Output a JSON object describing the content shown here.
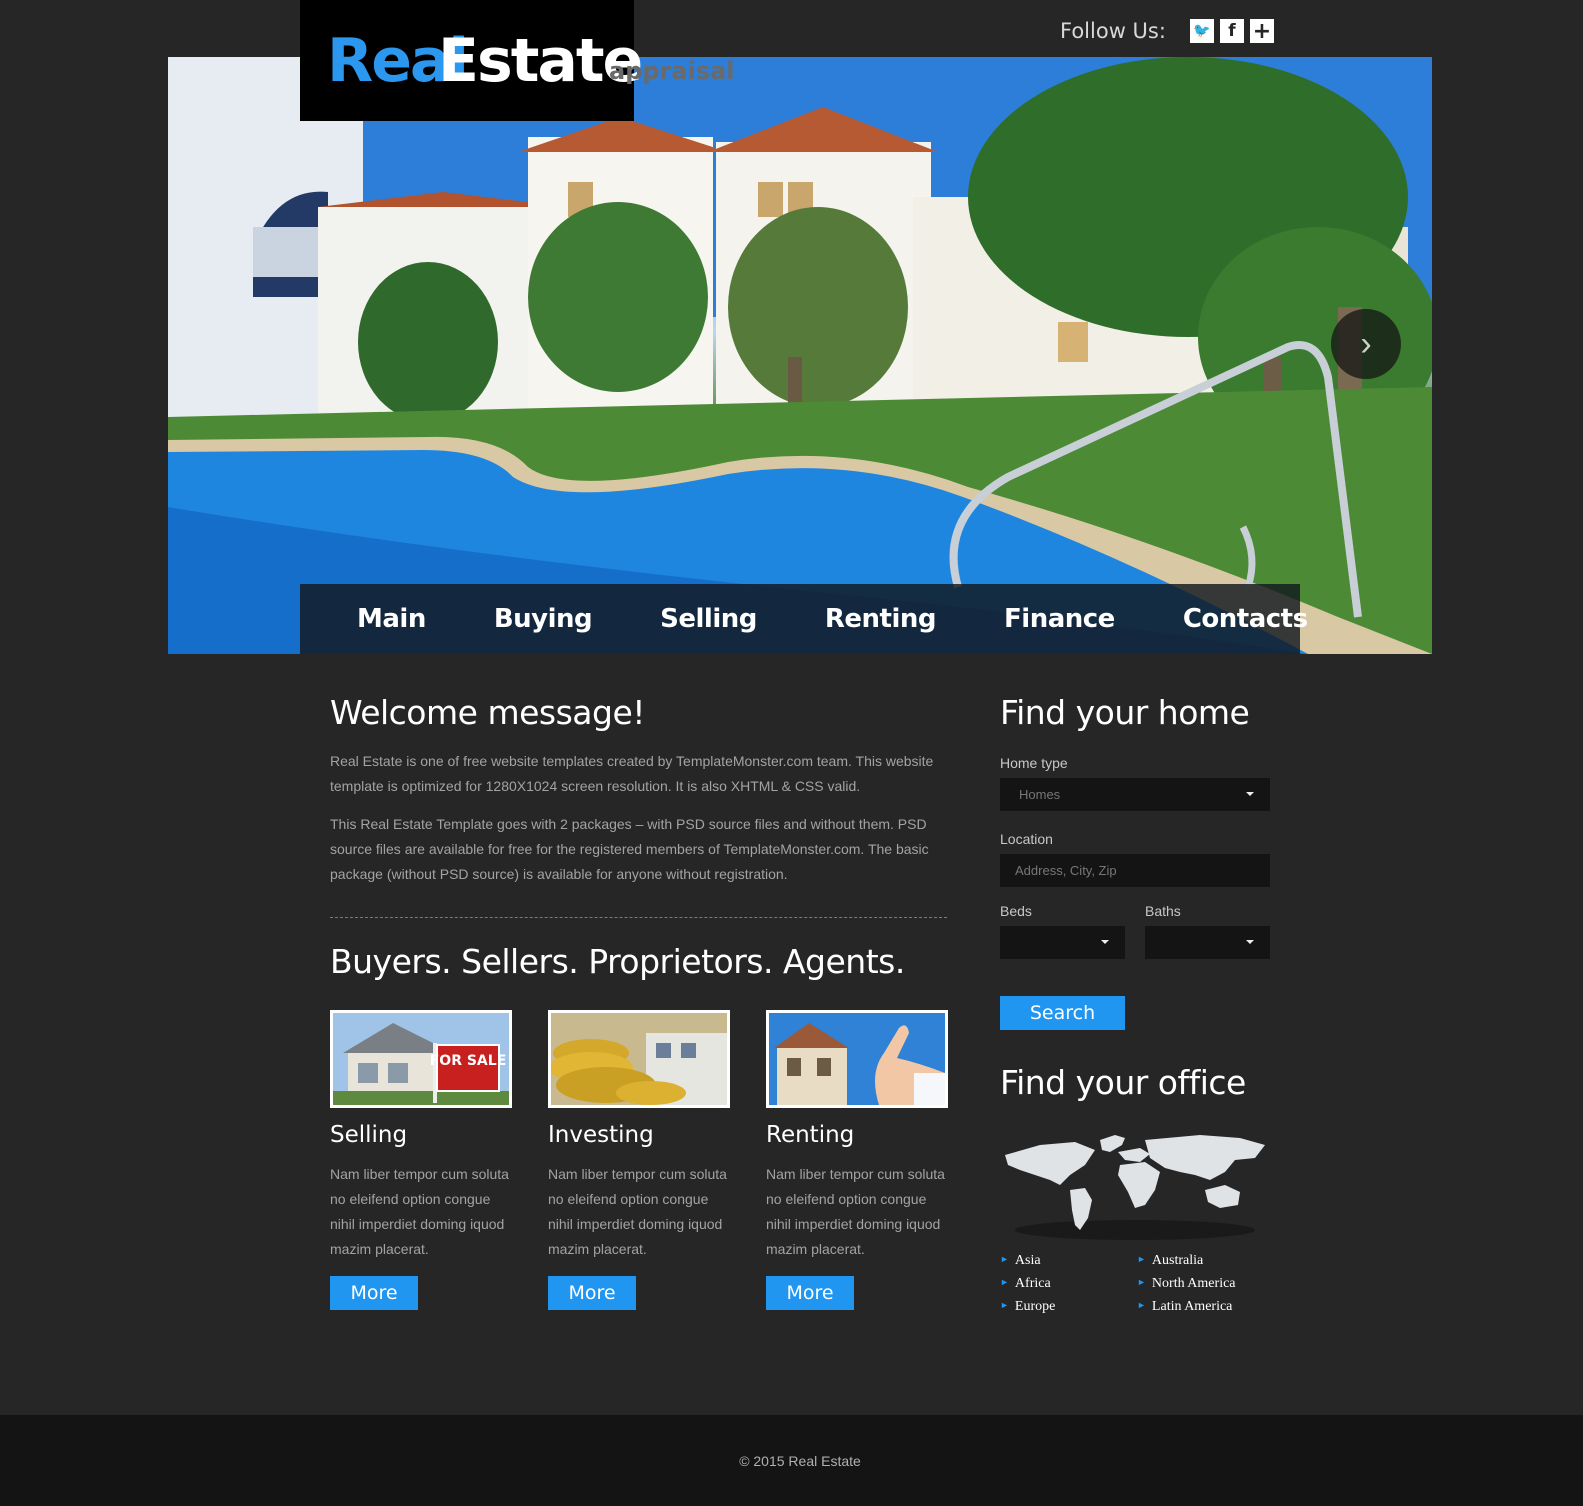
{
  "header": {
    "follow_label": "Follow Us:",
    "social": [
      {
        "icon": "twitter-icon",
        "glyph": "🐦"
      },
      {
        "icon": "facebook-icon",
        "glyph": "f"
      },
      {
        "icon": "google-plus-icon",
        "glyph": "+"
      }
    ]
  },
  "logo": {
    "real": "Real",
    "estate": "Estate",
    "tagline": "appraisal"
  },
  "slider": {
    "next_icon": "chevron-right-icon",
    "next_glyph": "›"
  },
  "nav": {
    "items": [
      "Main",
      "Buying",
      "Selling",
      "Renting",
      "Finance",
      "Contacts"
    ]
  },
  "welcome": {
    "title": "Welcome message!",
    "p1": "Real Estate is one of free website templates created by TemplateMonster.com team. This website template is optimized for 1280X1024 screen resolution. It is also XHTML & CSS valid.",
    "p2": "This Real Estate Template goes with 2 packages – with PSD source files and without them. PSD source files are available for free for the registered members of TemplateMonster.com. The basic package (without PSD source) is available for anyone without registration."
  },
  "buyers": {
    "title": "Buyers. Sellers. Proprietors. Agents.",
    "cards": [
      {
        "title": "Selling",
        "text": "Nam liber tempor cum soluta no eleifend option congue nihil imperdiet doming iquod mazim placerat.",
        "button": "More",
        "image_text": "FOR SALE"
      },
      {
        "title": "Investing",
        "text": "Nam liber tempor cum soluta no eleifend option congue nihil imperdiet doming iquod mazim placerat.",
        "button": "More"
      },
      {
        "title": "Renting",
        "text": "Nam liber tempor cum soluta no eleifend option congue nihil imperdiet doming iquod mazim placerat.",
        "button": "More"
      }
    ]
  },
  "find_home": {
    "title": "Find your home",
    "home_type_label": "Home type",
    "home_type_value": "Homes",
    "location_label": "Location",
    "location_placeholder": "Address, City, Zip",
    "beds_label": "Beds",
    "baths_label": "Baths",
    "beds_value": "",
    "baths_value": "",
    "search_button": "Search"
  },
  "find_office": {
    "title": "Find your office",
    "regions": [
      "Asia",
      "Africa",
      "Europe",
      "Australia",
      "North America",
      "Latin America"
    ]
  },
  "footer": {
    "copyright": "© 2015 Real Estate"
  },
  "colors": {
    "accent": "#2196f0",
    "background": "#262626",
    "footer": "#141414"
  }
}
